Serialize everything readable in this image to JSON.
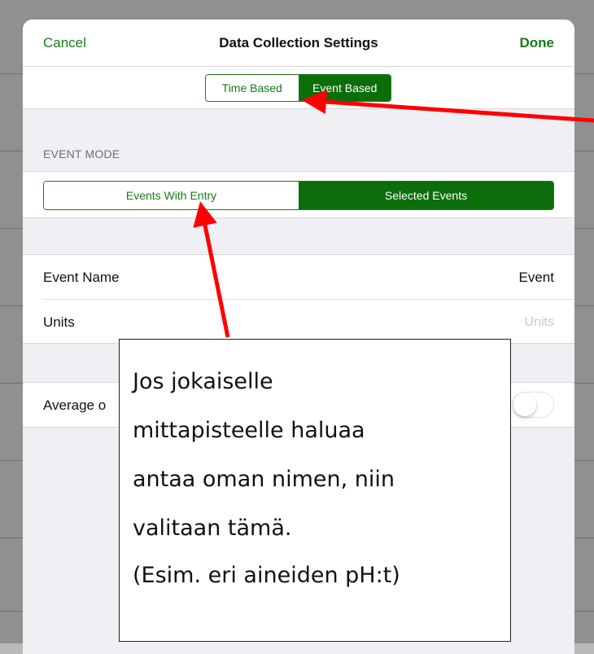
{
  "navbar": {
    "cancel_label": "Cancel",
    "title": "Data Collection Settings",
    "done_label": "Done"
  },
  "collection_mode": {
    "options": [
      "Time Based",
      "Event Based"
    ],
    "selected": "Event Based"
  },
  "event_mode": {
    "header": "EVENT MODE",
    "options": [
      "Events With Entry",
      "Selected Events"
    ],
    "selected": "Selected Events"
  },
  "fields": {
    "event_name": {
      "label": "Event Name",
      "value": "Event"
    },
    "units": {
      "label": "Units",
      "placeholder": "Units"
    }
  },
  "average": {
    "label": "Average o",
    "toggle_on": false
  },
  "annotation": {
    "lines": [
      "Jos jokaiselle",
      "mittapisteelle haluaa",
      "antaa oman nimen, niin",
      "valitaan tämä."
    ],
    "note": "(Esim. eri aineiden pH:t)"
  },
  "colors": {
    "accent_green": "#0b6e0b",
    "arrow_red": "#ff0000"
  }
}
